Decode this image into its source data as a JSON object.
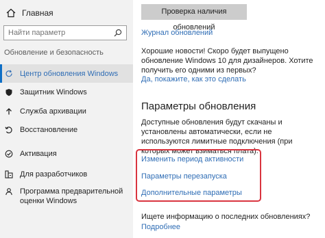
{
  "sidebar": {
    "home_label": "Главная",
    "search_placeholder": "Найти параметр",
    "section_title": "Обновление и безопасность",
    "items": [
      {
        "label": "Центр обновления Windows",
        "icon": "refresh-icon",
        "active": true
      },
      {
        "label": "Защитник Windows",
        "icon": "shield-icon",
        "active": false
      },
      {
        "label": "Служба архивации",
        "icon": "backup-arrow-icon",
        "active": false
      },
      {
        "label": "Восстановление",
        "icon": "recovery-icon",
        "active": false
      },
      {
        "label": "Активация",
        "icon": "check-circle-icon",
        "active": false
      },
      {
        "label": "Для разработчиков",
        "icon": "developer-icon",
        "active": false
      },
      {
        "label": "Программа предварительной оценки Windows",
        "icon": "insider-icon",
        "active": false
      }
    ]
  },
  "main": {
    "check_updates_button": "Проверка наличия обновлений",
    "update_log_link": "Журнал обновлений",
    "news_text": "Хорошие новости! Скоро будет выпущено обновление Windows 10 для дизайнеров. Хотите получить его одними из первых?",
    "news_link": "Да, покажите, как это сделать",
    "settings_heading": "Параметры обновления",
    "settings_text": "Доступные обновления будут скачаны и установлены автоматически, если не используются лимитные подключения (при которых может взиматься плата).",
    "settings_links": [
      "Изменить период активности",
      "Параметры перезапуска",
      "Дополнительные параметры"
    ],
    "info_question": "Ищете информацию о последних обновлениях?",
    "more_link": "Подробнее"
  },
  "colors": {
    "accent": "#0f6fc6",
    "link": "#2f6db5",
    "highlight_box": "#d9343f",
    "sidebar_bg": "#f2f2f2"
  }
}
